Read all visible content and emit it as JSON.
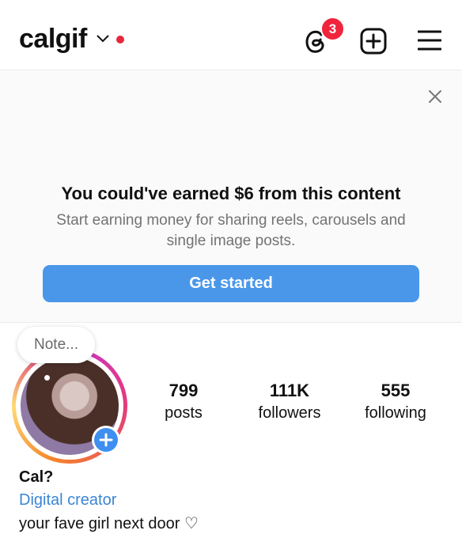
{
  "header": {
    "username": "calgif",
    "notification_count": "3"
  },
  "banner": {
    "title": "You could've earned $6 from this content",
    "subtitle": "Start earning money for sharing reels, carousels and single image posts.",
    "cta_label": "Get started"
  },
  "profile": {
    "note_placeholder": "Note...",
    "stats": [
      {
        "value": "799",
        "label": "posts"
      },
      {
        "value": "111K",
        "label": "followers"
      },
      {
        "value": "555",
        "label": "following"
      }
    ],
    "name": "Cal?",
    "category": "Digital creator",
    "bio": "your fave girl next door ♡"
  },
  "colors": {
    "accent": "#4a97ea",
    "badge": "#f0243c",
    "link": "#3b86d4"
  },
  "icons": [
    "chevron-down-icon",
    "threads-icon",
    "new-post-icon",
    "menu-icon",
    "close-icon",
    "add-story-icon"
  ]
}
